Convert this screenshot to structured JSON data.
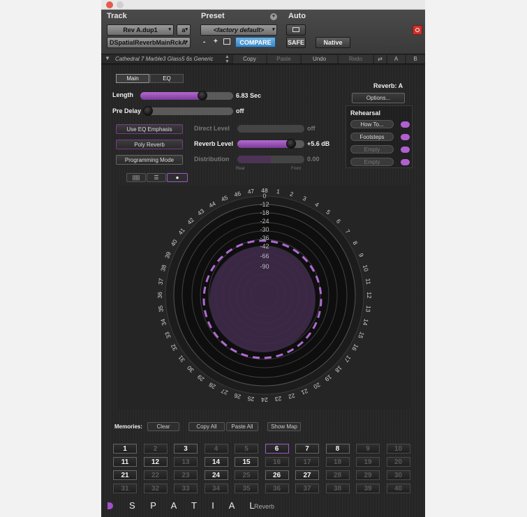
{
  "header": {
    "track_label": "Track",
    "preset_label": "Preset",
    "auto_label": "Auto",
    "track_select": "Rev A.dup1",
    "track_suffix": "a",
    "insert_select": "DSpatialReverbMainRckA",
    "preset_select": "<factory default>",
    "minus": "-",
    "plus": "+",
    "compare": "COMPARE",
    "safe": "SAFE",
    "native": "Native"
  },
  "toolbar": {
    "preset_name": "Cathedral 7 Marble3 Glass5 6s Generic",
    "copy": "Copy",
    "paste": "Paste",
    "undo": "Undo",
    "redo": "Redo",
    "a": "A",
    "b": "B"
  },
  "plugin": {
    "tabs": [
      "Main",
      "EQ"
    ],
    "reverb_label": "Reverb: A",
    "options": "Options...",
    "length": {
      "label": "Length",
      "value": "6.83 Sec",
      "level": 0.67
    },
    "predelay": {
      "label": "Pre Delay",
      "value": "off",
      "level": 0.0
    },
    "buttons": [
      "Use EQ Emphasis",
      "Poly Reverb",
      "Programming Mode"
    ],
    "direct_level": {
      "label": "Direct Level",
      "value": "off",
      "level": 0.0
    },
    "reverb_level": {
      "label": "Reverb Level",
      "value": "+5.6 dB",
      "level": 0.8
    },
    "distribution": {
      "label": "Distribution",
      "value": "0.00",
      "level": 0.5,
      "left": "Rear",
      "right": "Front"
    },
    "rehearsal": {
      "title": "Rehearsal",
      "items": [
        "How To...",
        "Footsteps",
        "Empty",
        "Empty"
      ]
    }
  },
  "display": {
    "ring_labels": [
      "0",
      "-12",
      "-18",
      "-24",
      "-30",
      "-36",
      "-42",
      "-66",
      "-90"
    ],
    "angle_numbers": [
      "1",
      "2",
      "3",
      "4",
      "5",
      "6",
      "7",
      "8",
      "9",
      "10",
      "11",
      "12",
      "13",
      "14",
      "15",
      "16",
      "17",
      "18",
      "19",
      "20",
      "21",
      "22",
      "23",
      "24",
      "25",
      "26",
      "27",
      "28",
      "29",
      "30",
      "31",
      "32",
      "33",
      "34",
      "35",
      "36",
      "37",
      "38",
      "39",
      "40",
      "41",
      "42",
      "43",
      "44",
      "45",
      "46",
      "47",
      "48"
    ]
  },
  "memories": {
    "label": "Memories:",
    "clear": "Clear",
    "copy_all": "Copy All",
    "paste_all": "Paste All",
    "show_map": "Show Map",
    "slots": [
      "1",
      "2",
      "3",
      "4",
      "5",
      "6",
      "7",
      "8",
      "9",
      "10",
      "11",
      "12",
      "13",
      "14",
      "15",
      "16",
      "17",
      "18",
      "19",
      "20",
      "21",
      "22",
      "23",
      "24",
      "25",
      "26",
      "27",
      "28",
      "29",
      "30",
      "31",
      "32",
      "33",
      "34",
      "35",
      "36",
      "37",
      "38",
      "39",
      "40"
    ],
    "active": [
      "1",
      "3",
      "6",
      "7",
      "8",
      "11",
      "12",
      "14",
      "15",
      "21",
      "24",
      "26",
      "27"
    ],
    "selected": "6"
  },
  "brand": {
    "name": "S P A T I A L",
    "suffix": "Reverb"
  },
  "colors": {
    "accent": "#a050c8",
    "close": "#e0413b"
  }
}
